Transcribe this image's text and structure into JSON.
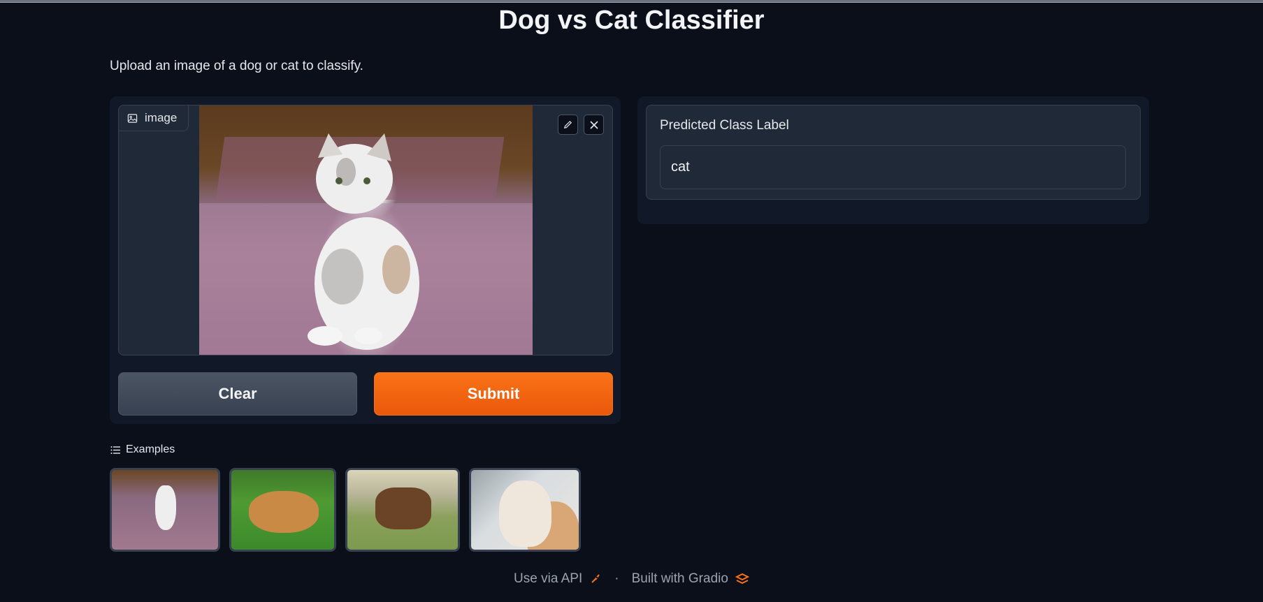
{
  "app": {
    "title": "Dog vs Cat Classifier",
    "description": "Upload an image of a dog or cat to classify."
  },
  "input": {
    "image_label": "image",
    "edit_icon": "pencil-icon",
    "close_icon": "close-icon"
  },
  "buttons": {
    "clear_label": "Clear",
    "submit_label": "Submit"
  },
  "output": {
    "label": "Predicted Class Label",
    "value": "cat"
  },
  "examples": {
    "heading": "Examples",
    "items": [
      "cat on rug",
      "fluffy dog on grass",
      "brown dog on leash",
      "cat by window"
    ]
  },
  "footer": {
    "api_label": "Use via API",
    "separator": "·",
    "built_with": "Built with Gradio"
  },
  "colors": {
    "background": "#0b0f19",
    "panel": "#111827",
    "accent": "#f97316"
  }
}
